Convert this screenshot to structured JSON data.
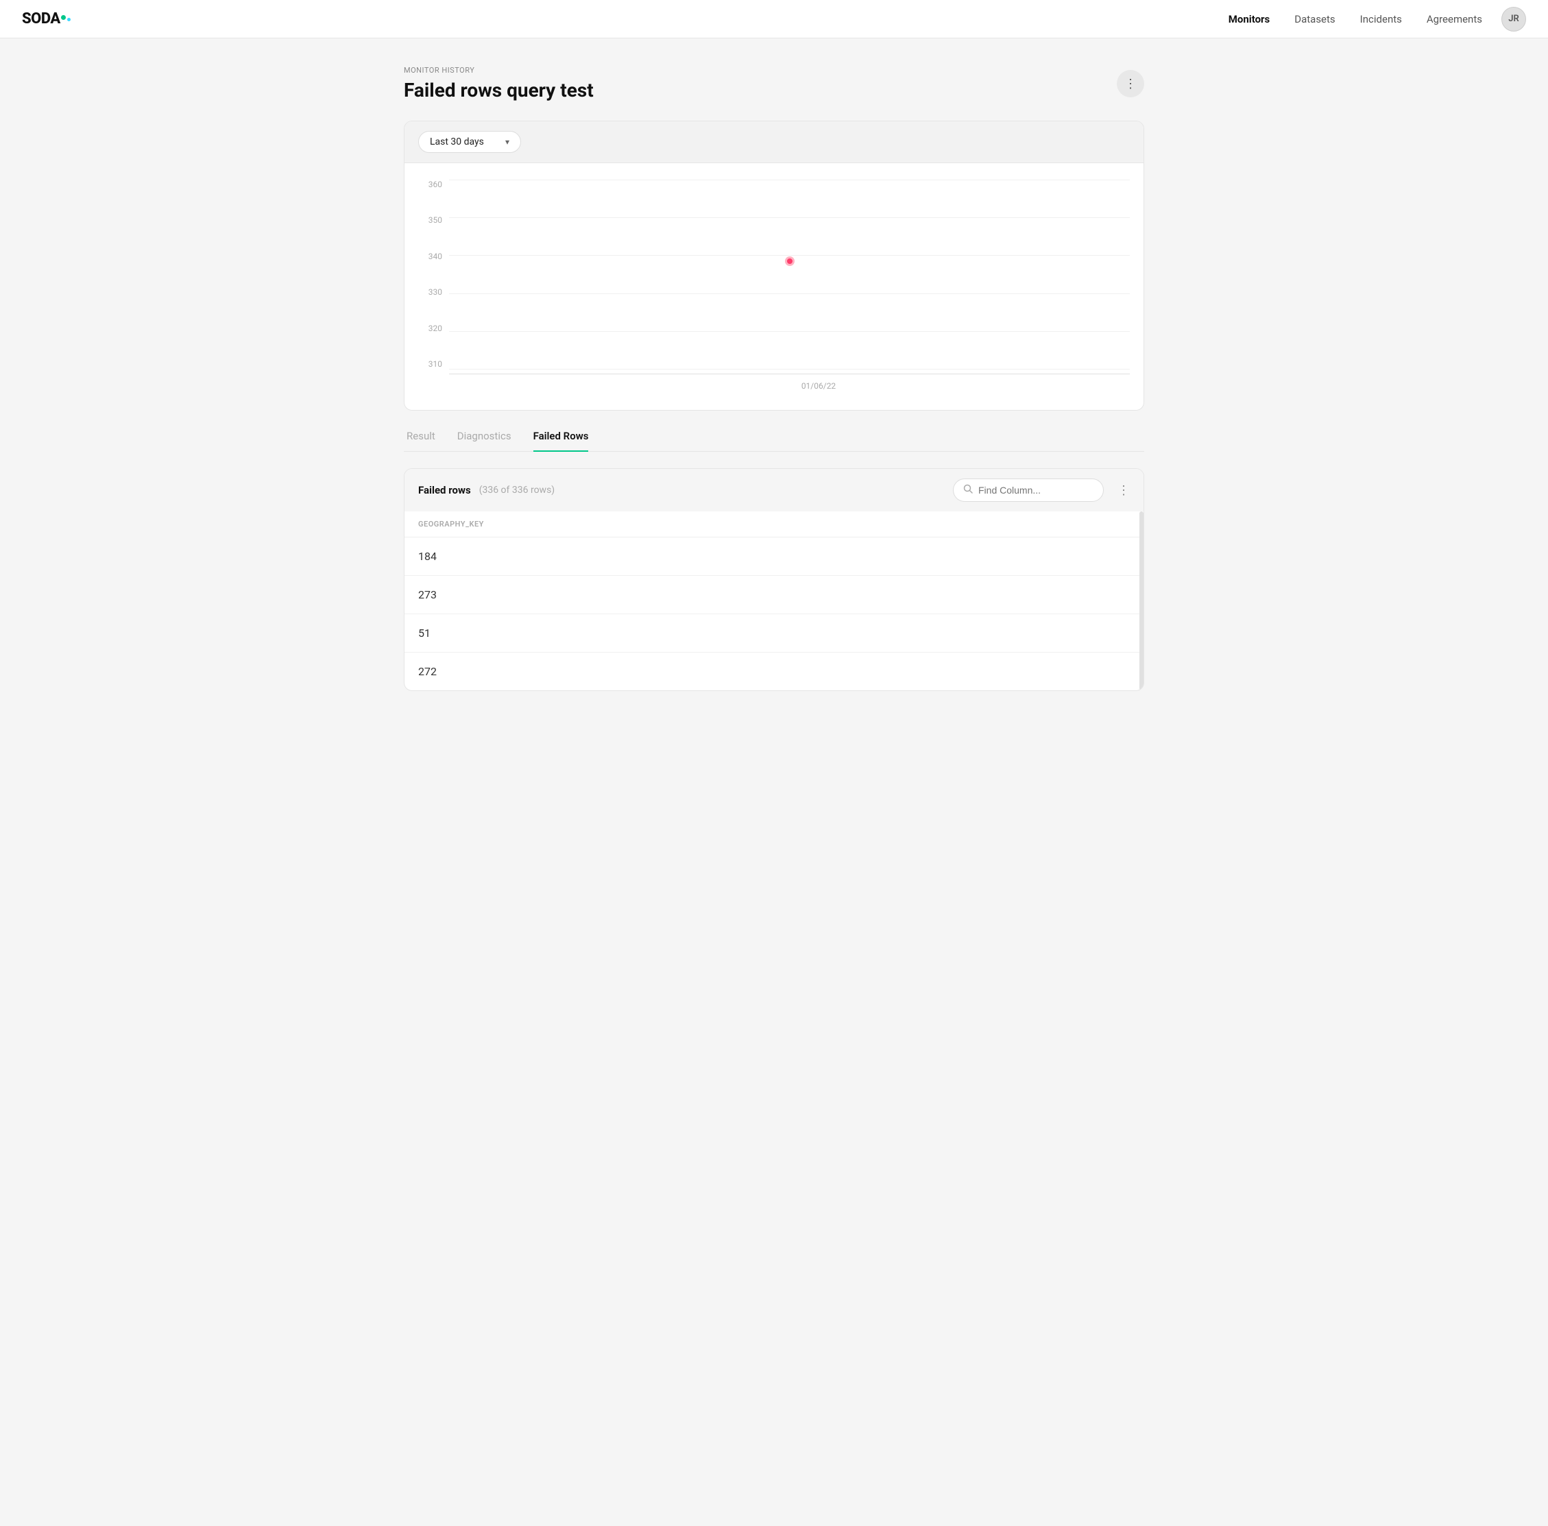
{
  "nav": {
    "logo": "SODA",
    "links": [
      "Monitors",
      "Datasets",
      "Incidents",
      "Agreements"
    ],
    "active_link": "Monitors",
    "user_initials": "JR"
  },
  "header": {
    "breadcrumb": "Monitor History",
    "title": "Failed rows query test",
    "more_button_label": "⋮"
  },
  "chart": {
    "date_filter": "Last 30 days",
    "date_filter_placeholder": "Last 30 days",
    "y_labels": [
      "360",
      "350",
      "340",
      "330",
      "320",
      "310"
    ],
    "x_label": "01/06/22",
    "data_point": {
      "x_percent": 50,
      "y_percent": 43
    }
  },
  "tabs": [
    {
      "label": "Result",
      "active": false
    },
    {
      "label": "Diagnostics",
      "active": false
    },
    {
      "label": "Failed Rows",
      "active": true
    }
  ],
  "failed_rows_table": {
    "title": "Failed rows",
    "row_count": "(336 of 336 rows)",
    "search_placeholder": "Find Column...",
    "more_button_label": "⋮",
    "column_header": "GEOGRAPHY_KEY",
    "rows": [
      {
        "value": "184"
      },
      {
        "value": "273"
      },
      {
        "value": "51"
      },
      {
        "value": "272"
      }
    ]
  },
  "icons": {
    "chevron_down": "▾",
    "search": "🔍",
    "more_vert": "⋮"
  }
}
